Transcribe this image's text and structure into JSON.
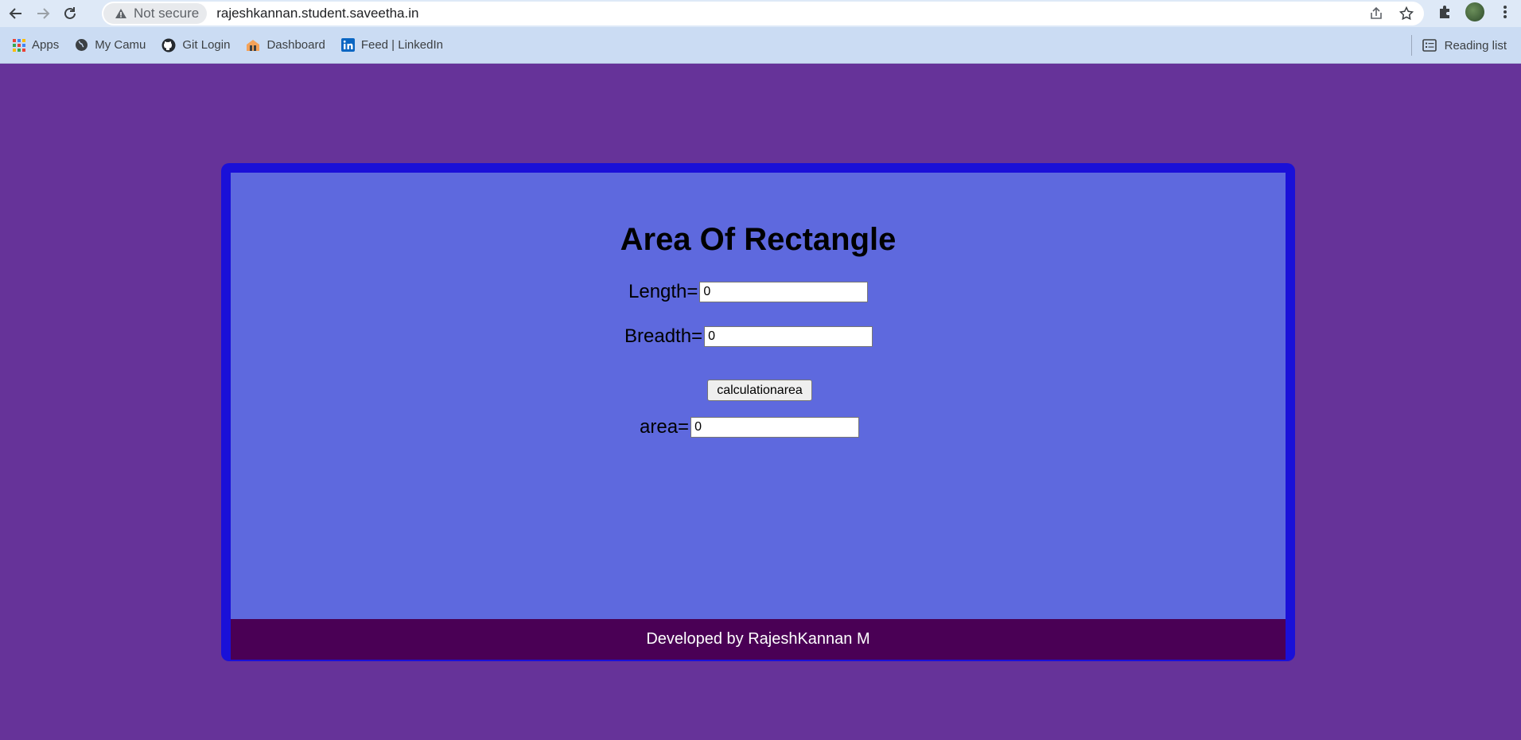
{
  "browser": {
    "security_label": "Not secure",
    "url": "rajeshkannan.student.saveetha.in",
    "bookmarks": [
      {
        "label": "Apps",
        "icon": "apps-grid-icon"
      },
      {
        "label": "My Camu",
        "icon": "globe-icon"
      },
      {
        "label": "Git Login",
        "icon": "github-icon"
      },
      {
        "label": "Dashboard",
        "icon": "dashboard-icon"
      },
      {
        "label": "Feed | LinkedIn",
        "icon": "linkedin-icon"
      }
    ],
    "reading_list": "Reading list"
  },
  "page": {
    "title": "Area Of Rectangle",
    "length_label": "Length=",
    "length_value": "0",
    "breadth_label": "Breadth=",
    "breadth_value": "0",
    "button_label": "calculationarea",
    "area_label": "area=",
    "area_value": "0",
    "footer": "Developed by RajeshKannan M"
  },
  "colors": {
    "page_background": "#663399",
    "card_border": "#1a10d8",
    "card_background": "#5e69de",
    "footer_background": "#4a0055"
  }
}
